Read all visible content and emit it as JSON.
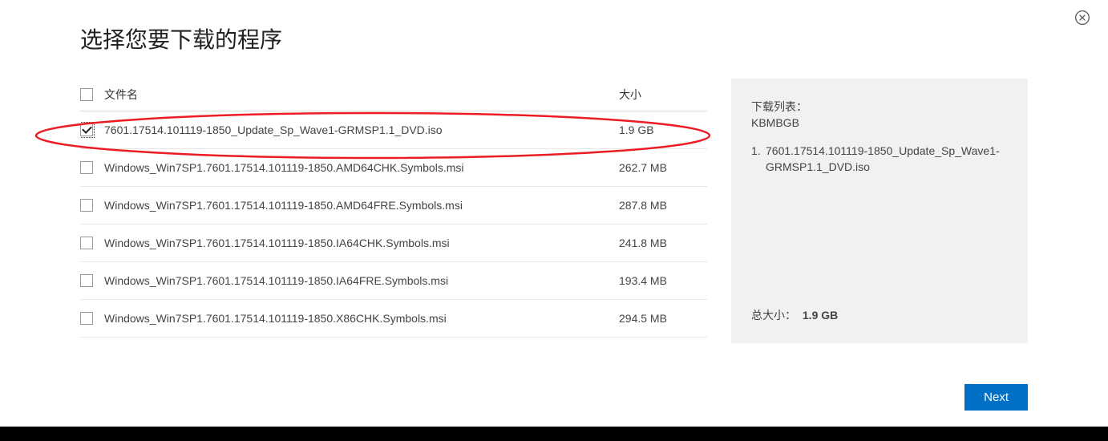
{
  "title": "选择您要下载的程序",
  "close_icon_name": "close-icon",
  "columns": {
    "filename": "文件名",
    "size": "大小"
  },
  "files": [
    {
      "name": "7601.17514.101119-1850_Update_Sp_Wave1-GRMSP1.1_DVD.iso",
      "size": "1.9 GB",
      "checked": true
    },
    {
      "name": "Windows_Win7SP1.7601.17514.101119-1850.AMD64CHK.Symbols.msi",
      "size": "262.7 MB",
      "checked": false
    },
    {
      "name": "Windows_Win7SP1.7601.17514.101119-1850.AMD64FRE.Symbols.msi",
      "size": "287.8 MB",
      "checked": false
    },
    {
      "name": "Windows_Win7SP1.7601.17514.101119-1850.IA64CHK.Symbols.msi",
      "size": "241.8 MB",
      "checked": false
    },
    {
      "name": "Windows_Win7SP1.7601.17514.101119-1850.IA64FRE.Symbols.msi",
      "size": "193.4 MB",
      "checked": false
    },
    {
      "name": "Windows_Win7SP1.7601.17514.101119-1850.X86CHK.Symbols.msi",
      "size": "294.5 MB",
      "checked": false
    }
  ],
  "sidebar": {
    "download_list_label": "下载列表：",
    "units": "KBMBGB",
    "items": [
      {
        "num": "1.",
        "name": "7601.17514.101119-1850_Update_Sp_Wave1-GRMSP1.1_DVD.iso"
      }
    ],
    "total_label": "总大小：",
    "total_value": "1.9 GB"
  },
  "next_label": "Next",
  "annotation": {
    "stroke": "#ed1c24"
  }
}
